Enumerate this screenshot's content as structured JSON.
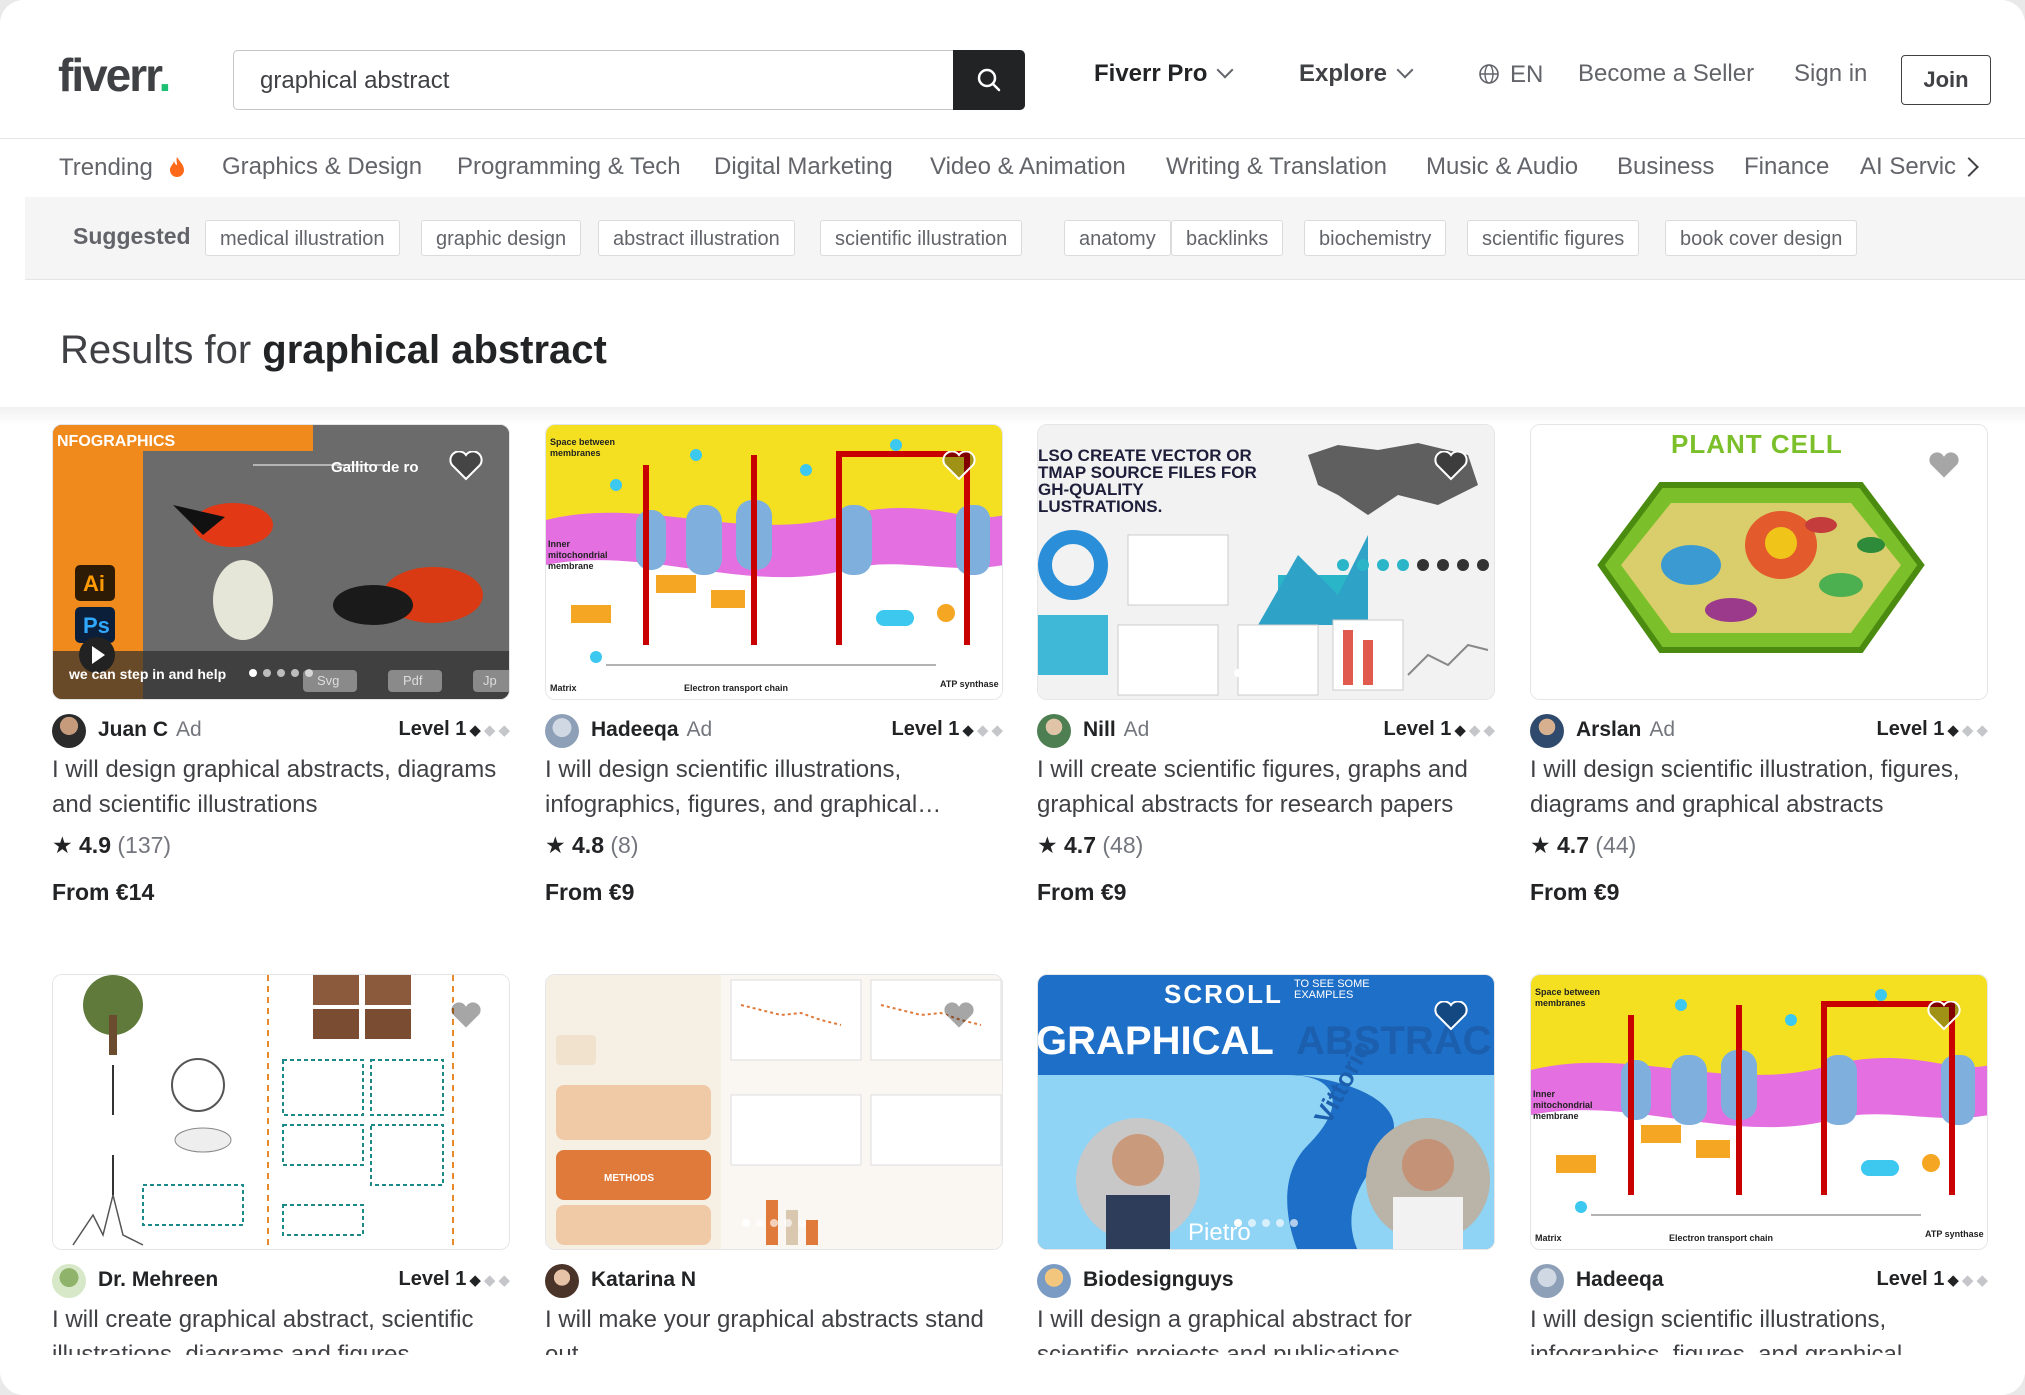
{
  "header": {
    "logo": "fiverr",
    "logo_dot": ".",
    "search_value": "graphical abstract",
    "fiverr_pro": "Fiverr Pro",
    "explore": "Explore",
    "language": "EN",
    "become_seller": "Become a Seller",
    "sign_in": "Sign in",
    "join": "Join"
  },
  "categories": {
    "trending": "Trending",
    "items": [
      "Graphics & Design",
      "Programming & Tech",
      "Digital Marketing",
      "Video & Animation",
      "Writing & Translation",
      "Music & Audio",
      "Business",
      "Finance",
      "AI Servic"
    ]
  },
  "suggested": {
    "title": "Suggested",
    "chips": [
      "medical illustration",
      "graphic design",
      "abstract illustration",
      "scientific illustration",
      "anatomy",
      "backlinks",
      "biochemistry",
      "scientific figures",
      "book cover design"
    ]
  },
  "results": {
    "prefix": "Results for",
    "query": "graphical abstract"
  },
  "gigs": [
    {
      "seller": "Juan C",
      "ad": "Ad",
      "level": "Level 1",
      "title": "I will design graphical abstracts, diagrams and scientific illustrations",
      "rating": "4.9",
      "reviews": "(137)",
      "price": "From €14",
      "thumb": {
        "top_label": "NFOGRAPHICS",
        "bird": "Gallito de ro",
        "ai": "Ai",
        "ps": "Ps",
        "caption": "we can step in and help",
        "svg": "Svg",
        "pdf": "Pdf",
        "jp": "Jp"
      }
    },
    {
      "seller": "Hadeeqa",
      "ad": "Ad",
      "level": "Level 1",
      "title": "I will design scientific illustrations, infographics, figures, and graphical…",
      "rating": "4.8",
      "reviews": "(8)",
      "price": "From €9",
      "thumb": {
        "space": "Space between membranes",
        "inner": "Inner mitochondrial membrane",
        "matrix": "Matrix",
        "etc": "Electron transport chain",
        "atp": "ATP synthase"
      }
    },
    {
      "seller": "Nill",
      "ad": "Ad",
      "level": "Level 1",
      "title": "I will create scientific figures, graphs and graphical abstracts for research papers",
      "rating": "4.7",
      "reviews": "(48)",
      "price": "From €9",
      "thumb": {
        "line1": "LSO CREATE VECTOR OR",
        "line2": "TMAP SOURCE FILES FOR",
        "line3": "GH-QUALITY",
        "line4": "LUSTRATIONS."
      }
    },
    {
      "seller": "Arslan",
      "ad": "Ad",
      "level": "Level 1",
      "title": "I will design scientific illustration, figures, diagrams and graphical abstracts",
      "rating": "4.7",
      "reviews": "(44)",
      "price": "From €9",
      "thumb": {
        "heading": "PLANT CELL"
      }
    },
    {
      "seller": "Dr. Mehreen",
      "ad": "",
      "level": "Level 1",
      "title": "I will create graphical abstract, scientific illustrations, diagrams and figures",
      "rating": "",
      "reviews": "",
      "price": "",
      "thumb": {}
    },
    {
      "seller": "Katarina N",
      "ad": "",
      "level": "",
      "title": "I will make your graphical abstracts stand out",
      "rating": "",
      "reviews": "",
      "price": "",
      "thumb": {
        "methods": "METHODS"
      }
    },
    {
      "seller": "Biodesignguys",
      "ad": "",
      "level": "",
      "title": "I will design a graphical abstract for scientific projects and publications",
      "rating": "",
      "reviews": "",
      "price": "",
      "thumb": {
        "scroll": "SCROLL",
        "see": "TO SEE SOME EXAMPLES",
        "graphical": "GRAPHICAL",
        "abstract": "ABSTRAC",
        "vittorio": "Vittorio",
        "pietro": "Pietro"
      }
    },
    {
      "seller": "Hadeeqa",
      "ad": "",
      "level": "Level 1",
      "title": "I will design scientific illustrations, infographics, figures, and graphical",
      "rating": "",
      "reviews": "",
      "price": "",
      "thumb": {
        "space": "Space between membranes",
        "inner": "Inner mitochondrial membrane",
        "matrix": "Matrix",
        "etc": "Electron transport chain",
        "atp": "ATP synthase"
      }
    }
  ],
  "colors": {
    "brand_green": "#1dbf73",
    "text_dark": "#222325",
    "text_gray": "#62646a",
    "fire": "#ff6a1a"
  }
}
